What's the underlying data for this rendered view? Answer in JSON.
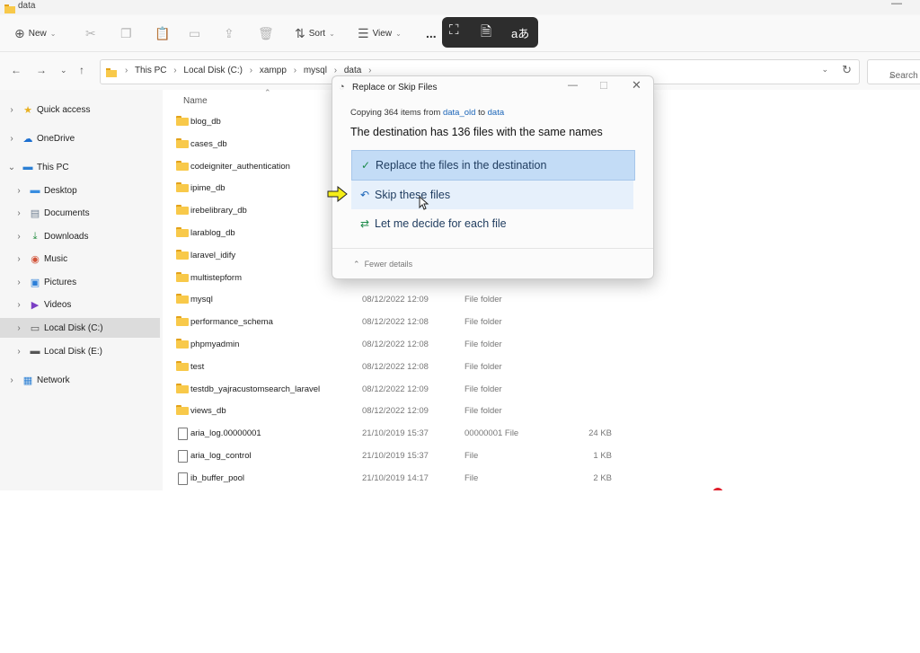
{
  "window": {
    "title": "data"
  },
  "toolbar": {
    "new_label": "New",
    "sort_label": "Sort",
    "view_label": "View",
    "more_label": "..."
  },
  "overlay_icons": [
    "crop-icon",
    "document-sparkle-icon",
    "translate-icon"
  ],
  "overlay": {
    "translate_glyph": "aあ"
  },
  "address": {
    "crumbs": [
      "This PC",
      "Local Disk (C:)",
      "xampp",
      "mysql",
      "data"
    ],
    "search_placeholder": "Search"
  },
  "sidebar": {
    "items": [
      {
        "label": "Quick access",
        "icon": "star-icon"
      },
      {
        "label": "OneDrive",
        "icon": "cloud-icon"
      },
      {
        "label": "This PC",
        "icon": "pc-icon"
      },
      {
        "label": "Desktop",
        "icon": "desktop-icon"
      },
      {
        "label": "Documents",
        "icon": "documents-icon"
      },
      {
        "label": "Downloads",
        "icon": "download-icon"
      },
      {
        "label": "Music",
        "icon": "music-icon"
      },
      {
        "label": "Pictures",
        "icon": "pictures-icon"
      },
      {
        "label": "Videos",
        "icon": "videos-icon"
      },
      {
        "label": "Local Disk (C:)",
        "icon": "drive-icon",
        "selected": true
      },
      {
        "label": "Local Disk (E:)",
        "icon": "drive-icon"
      },
      {
        "label": "Network",
        "icon": "network-icon"
      }
    ]
  },
  "files": {
    "header_name": "Name",
    "rows": [
      {
        "name": "blog_db",
        "date": "",
        "type": "",
        "size": "",
        "kind": "folder"
      },
      {
        "name": "cases_db",
        "date": "",
        "type": "",
        "size": "",
        "kind": "folder"
      },
      {
        "name": "codeigniter_authentication",
        "date": "",
        "type": "",
        "size": "",
        "kind": "folder"
      },
      {
        "name": "ipime_db",
        "date": "",
        "type": "",
        "size": "",
        "kind": "folder"
      },
      {
        "name": "irebelibrary_db",
        "date": "",
        "type": "",
        "size": "",
        "kind": "folder"
      },
      {
        "name": "larablog_db",
        "date": "",
        "type": "",
        "size": "",
        "kind": "folder"
      },
      {
        "name": "laravel_idify",
        "date": "",
        "type": "",
        "size": "",
        "kind": "folder"
      },
      {
        "name": "multistepform",
        "date": "",
        "type": "",
        "size": "",
        "kind": "folder"
      },
      {
        "name": "mysql",
        "date": "08/12/2022 12:09",
        "type": "File folder",
        "size": "",
        "kind": "folder"
      },
      {
        "name": "performance_schema",
        "date": "08/12/2022 12:08",
        "type": "File folder",
        "size": "",
        "kind": "folder"
      },
      {
        "name": "phpmyadmin",
        "date": "08/12/2022 12:08",
        "type": "File folder",
        "size": "",
        "kind": "folder"
      },
      {
        "name": "test",
        "date": "08/12/2022 12:08",
        "type": "File folder",
        "size": "",
        "kind": "folder"
      },
      {
        "name": "testdb_yajracustomsearch_laravel",
        "date": "08/12/2022 12:09",
        "type": "File folder",
        "size": "",
        "kind": "folder"
      },
      {
        "name": "views_db",
        "date": "08/12/2022 12:09",
        "type": "File folder",
        "size": "",
        "kind": "folder"
      },
      {
        "name": "aria_log.00000001",
        "date": "21/10/2019 15:37",
        "type": "00000001 File",
        "size": "24 KB",
        "kind": "file"
      },
      {
        "name": "aria_log_control",
        "date": "21/10/2019 15:37",
        "type": "File",
        "size": "1 KB",
        "kind": "file"
      },
      {
        "name": "ib_buffer_pool",
        "date": "21/10/2019 14:17",
        "type": "File",
        "size": "2 KB",
        "kind": "file"
      }
    ]
  },
  "dialog": {
    "title": "Replace or Skip Files",
    "copy_prefix": "Copying 364 items from",
    "source": "data_old",
    "to_word": "to",
    "dest": "data",
    "summary": "The destination has 136 files with the same names",
    "option_replace": "Replace the files in the destination",
    "option_skip": "Skip these files",
    "option_decide": "Let me decide for each file",
    "fewer_details": "Fewer details"
  },
  "colors": {
    "accent": "#1a64b8",
    "option_selected_bg": "#c3dcf6",
    "option_hover_bg": "#e6f0fb",
    "folder_yellow": "#f8c94a",
    "annotation_arrow": "#f5ee18"
  }
}
